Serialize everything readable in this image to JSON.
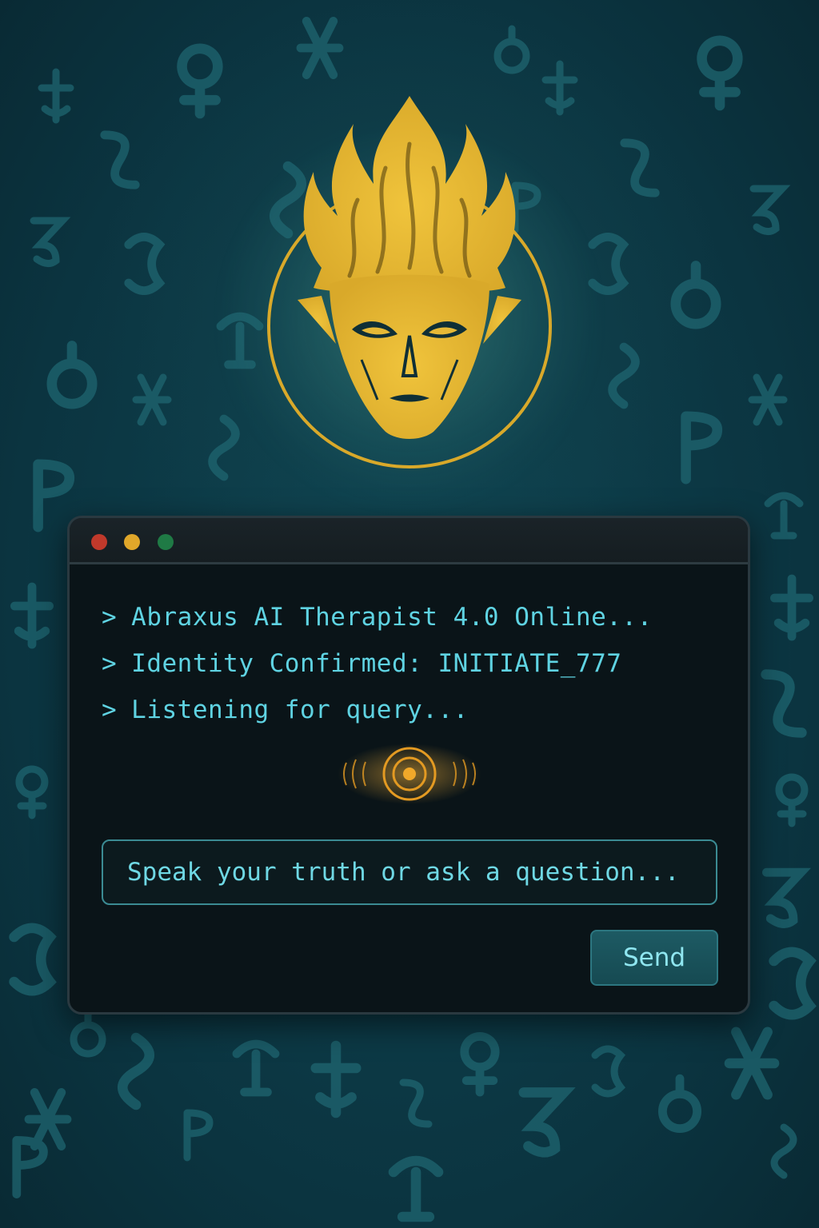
{
  "colors": {
    "background": "#0b3440",
    "glyph": "#1f6670",
    "emblem_gold": "#e0b533",
    "terminal_bg": "#0a1418",
    "console_text": "#5fd3e2",
    "signal_orange": "#e39a22",
    "button_bg": "#1d5a63",
    "dot_red": "#c0392b",
    "dot_yellow": "#e0a72a",
    "dot_green": "#1f7a45"
  },
  "emblem": {
    "icon": "flame-haired-face-icon"
  },
  "window": {
    "controls": [
      "close-dot",
      "minimize-dot",
      "maximize-dot"
    ]
  },
  "console": {
    "prompt_symbol": ">",
    "lines": [
      "Abraxus AI Therapist 4.0 Online...",
      "Identity Confirmed: INITIATE_777",
      "Listening for query..."
    ]
  },
  "signal": {
    "icon": "listening-waveform-icon"
  },
  "input": {
    "placeholder": "Speak your truth or ask a question...",
    "value": ""
  },
  "actions": {
    "send_label": "Send"
  }
}
